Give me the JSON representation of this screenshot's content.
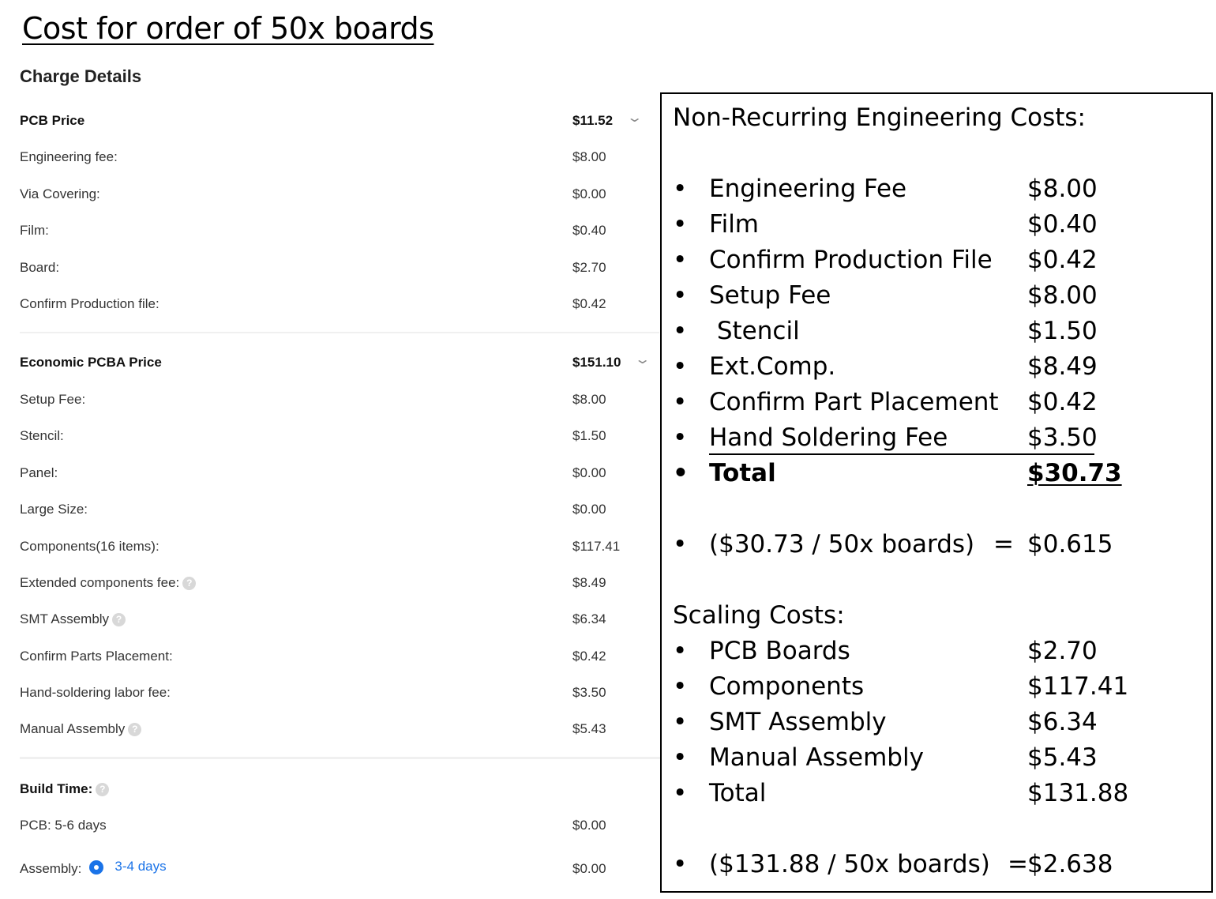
{
  "heading": "Cost for order of 50x boards",
  "charge_details": {
    "title": "Charge Details",
    "pcb": {
      "label": "PCB Price",
      "value": "$11.52",
      "items": [
        {
          "label": "Engineering fee:",
          "value": "$8.00"
        },
        {
          "label": "Via Covering:",
          "value": "$0.00"
        },
        {
          "label": "Film:",
          "value": "$0.40"
        },
        {
          "label": "Board:",
          "value": "$2.70"
        },
        {
          "label": "Confirm Production file:",
          "value": "$0.42"
        }
      ]
    },
    "pcba": {
      "label": "Economic PCBA Price",
      "value": "$151.10",
      "items": [
        {
          "label": "Setup Fee:",
          "value": "$8.00"
        },
        {
          "label": "Stencil:",
          "value": "$1.50"
        },
        {
          "label": "Panel:",
          "value": "$0.00"
        },
        {
          "label": "Large Size:",
          "value": "$0.00"
        },
        {
          "label": "Components(16 items):",
          "value": "$117.41"
        },
        {
          "label": "Extended components fee:",
          "value": "$8.49"
        },
        {
          "label": "SMT Assembly",
          "value": "$6.34"
        },
        {
          "label": "Confirm Parts Placement:",
          "value": "$0.42"
        },
        {
          "label": "Hand-soldering labor fee:",
          "value": "$3.50"
        },
        {
          "label": "Manual Assembly",
          "value": "$5.43"
        }
      ]
    },
    "build_time": {
      "label": "Build Time:",
      "pcb_label": "PCB:  5-6 days",
      "pcb_value": "$0.00",
      "assembly_label": "Assembly:",
      "assembly_option": "3-4 days",
      "assembly_value": "$0.00"
    }
  },
  "summary": {
    "nre_title": "Non-Recurring Engineering Costs:",
    "nre_items": [
      {
        "name": "Engineering Fee",
        "amount": "$8.00"
      },
      {
        "name": "Film",
        "amount": "$0.40"
      },
      {
        "name": "Confirm Production File",
        "amount": "$0.42"
      },
      {
        "name": "Setup Fee",
        "amount": "$8.00"
      },
      {
        "name": " Stencil",
        "amount": "$1.50"
      },
      {
        "name": "Ext.Comp.",
        "amount": "$8.49"
      },
      {
        "name": "Confirm Part Placement",
        "amount": "$0.42"
      },
      {
        "name": "Hand Soldering Fee",
        "amount": "$3.50"
      }
    ],
    "nre_total": {
      "name": "Total",
      "amount": "$30.73"
    },
    "nre_per_board": {
      "expr": "($30.73 / 50x boards)",
      "eq": "=",
      "result": "$0.615"
    },
    "scaling_title": "Scaling Costs:",
    "scaling_items": [
      {
        "name": "PCB Boards",
        "amount": "$2.70"
      },
      {
        "name": "Components",
        "amount": "$117.41"
      },
      {
        "name": "SMT Assembly",
        "amount": "$6.34"
      },
      {
        "name": "Manual Assembly",
        "amount": "$5.43"
      },
      {
        "name": "Total",
        "amount": "$131.88"
      }
    ],
    "scaling_per_board": {
      "expr": "($131.88 / 50x boards)",
      "eq": "=",
      "result": "$2.638"
    },
    "bullet": "•"
  },
  "icons": {
    "chevron": "chevron-down-icon",
    "help": "question-circle-icon",
    "radio": "radio-selected-icon"
  },
  "colors": {
    "accent": "#1a73e8",
    "help_icon": "#d8d8d8"
  }
}
